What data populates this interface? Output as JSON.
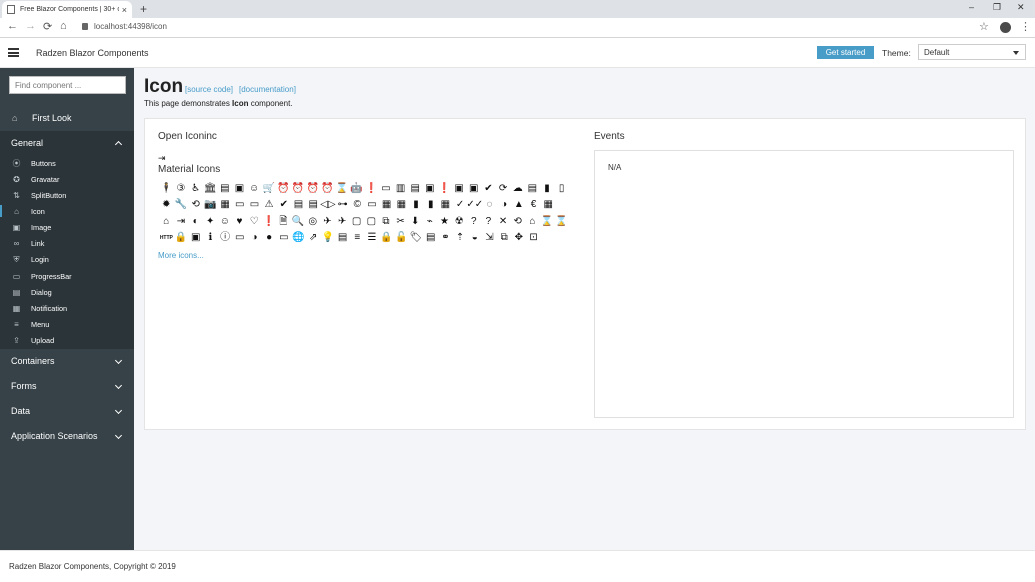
{
  "browser": {
    "tab_title": "Free Blazor Components | 30+ c...",
    "tab_close": "×",
    "new_tab": "+",
    "url": "localhost:44398/icon",
    "window_controls": [
      "–",
      "❐",
      "✕"
    ]
  },
  "header": {
    "title": "Radzen Blazor Components",
    "get_started": "Get started",
    "theme_label": "Theme:",
    "theme_value": "Default"
  },
  "sidebar": {
    "search_placeholder": "Find component ...",
    "first_look": "First Look",
    "general": "General",
    "items": [
      {
        "label": "Buttons",
        "icon": "⦿"
      },
      {
        "label": "Gravatar",
        "icon": "✪"
      },
      {
        "label": "SplitButton",
        "icon": "⇅"
      },
      {
        "label": "Icon",
        "icon": "⌂"
      },
      {
        "label": "Image",
        "icon": "▣"
      },
      {
        "label": "Link",
        "icon": "∞"
      },
      {
        "label": "Login",
        "icon": "⛨"
      },
      {
        "label": "ProgressBar",
        "icon": "▭"
      },
      {
        "label": "Dialog",
        "icon": "▤"
      },
      {
        "label": "Notification",
        "icon": "▦"
      },
      {
        "label": "Menu",
        "icon": "≡"
      },
      {
        "label": "Upload",
        "icon": "⇪"
      }
    ],
    "containers": "Containers",
    "forms": "Forms",
    "data": "Data",
    "app_scenarios": "Application Scenarios"
  },
  "main": {
    "title": "Icon",
    "source_code": "[source code]",
    "documentation": "[documentation]",
    "desc_pre": "This page demonstrates ",
    "desc_bold": "Icon",
    "desc_post": " component.",
    "open_iconic": "Open Iconinc",
    "material_icons": "Material Icons",
    "more_icons": "More icons...",
    "events_title": "Events",
    "events_text": "N/A"
  },
  "icon_rows": [
    [
      "🕴",
      "③",
      "♿",
      "🏛",
      "▤",
      "▣",
      "☺",
      "🛒",
      "⏰",
      "⏰",
      "⏰",
      "⏰",
      "⌛",
      "🤖",
      "❗",
      "▭",
      "▥",
      "▤",
      "▣",
      "❗",
      "▣",
      "▣",
      "✔",
      "⟳",
      "☁",
      "▤",
      "▮",
      "▯"
    ],
    [
      "✹",
      "🔧",
      "⟲",
      "📷",
      "▦",
      "▭",
      "▭",
      "⚠",
      "✔",
      "▤",
      "▤",
      "◁▷",
      "⊶",
      "©",
      "▭",
      "▦",
      "▦",
      "▮",
      "▮",
      "▦",
      "✓",
      "✓✓",
      "◌",
      "◑",
      "▲",
      "€",
      "▦"
    ],
    [
      "⌂",
      "⇥",
      "◐",
      "✦",
      "☺",
      "♥",
      "♡",
      "❗",
      "🗎",
      "🔍",
      "◎",
      "✈",
      "✈",
      "▢",
      "▢",
      "⧉",
      "✂",
      "⬇",
      "⌁",
      "★",
      "☢",
      "?",
      "?",
      "✕",
      "⟲",
      "⌂",
      "⌛",
      "⌛"
    ],
    [
      "HTTP",
      "🔒",
      "▣",
      "ℹ",
      "ⓘ",
      "▭",
      "◑",
      "●",
      "▭",
      "🌐",
      "⇗",
      "💡",
      "▤",
      "≡",
      "☰",
      "🔒",
      "🔓",
      "🏷",
      "▤",
      "⚭",
      "⇡",
      "◒",
      "⇲",
      "⧉",
      "✥",
      "⊡"
    ]
  ],
  "footer": {
    "text": "Radzen Blazor Components, Copyright © 2019"
  }
}
